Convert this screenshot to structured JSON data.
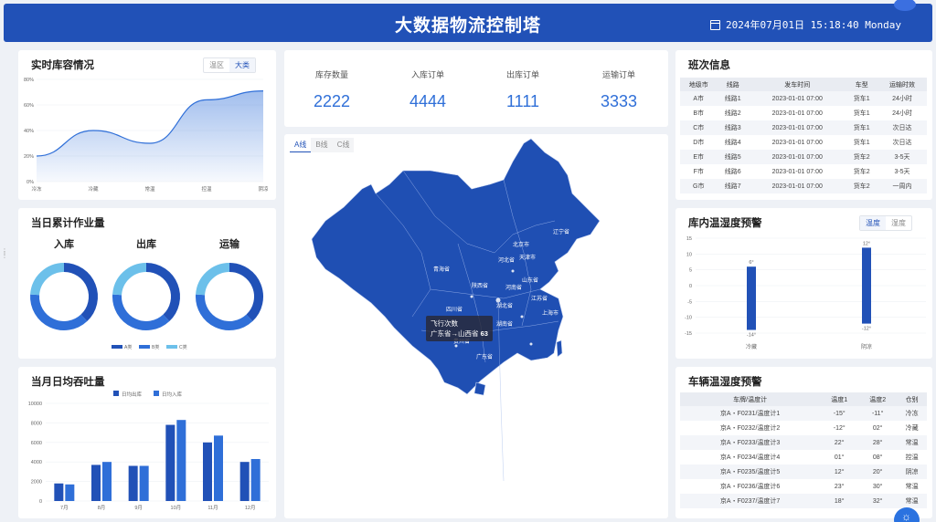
{
  "header": {
    "title": "大数据物流控制塔",
    "datetime": "2024年07月01日 15:18:40 Monday"
  },
  "inventory": {
    "title": "实时库容情况",
    "tabs": [
      "温区",
      "大类"
    ],
    "active_tab": "大类",
    "chart_data": {
      "type": "area",
      "categories": [
        "冷冻",
        "冷藏",
        "常温",
        "控温",
        "阴凉"
      ],
      "values": [
        20,
        40,
        30,
        64,
        71
      ],
      "ylim": [
        0,
        80
      ],
      "ytick_labels": [
        "0%",
        "20%",
        "40%",
        "60%",
        "80%"
      ],
      "color": "#2f6fd8"
    }
  },
  "daily_ops": {
    "title": "当日累计作业量",
    "chart_data": {
      "type": "pie",
      "charts": [
        {
          "title": "入库",
          "values": [
            38,
            38,
            24
          ]
        },
        {
          "title": "出库",
          "values": [
            38,
            38,
            24
          ]
        },
        {
          "title": "运输",
          "values": [
            38,
            38,
            24
          ]
        }
      ],
      "legend": [
        "A类",
        "B类",
        "C类"
      ],
      "colors": [
        "#2151b7",
        "#2f6fd8",
        "#6cc0ea"
      ]
    }
  },
  "monthly": {
    "title": "当月日均吞吐量",
    "chart_data": {
      "type": "bar",
      "categories": [
        "7月",
        "8月",
        "9月",
        "10月",
        "11月",
        "12月"
      ],
      "series": [
        {
          "name": "日均出库",
          "values": [
            1800,
            3700,
            3600,
            7800,
            6000,
            4000
          ],
          "color": "#2151b7"
        },
        {
          "name": "日均入库",
          "values": [
            1700,
            4000,
            3600,
            8300,
            6700,
            4300
          ],
          "color": "#2f6fd8"
        }
      ],
      "ylim": [
        0,
        10000
      ],
      "yticks": [
        0,
        2000,
        4000,
        6000,
        8000,
        10000
      ]
    }
  },
  "stats": [
    {
      "label": "库存数量",
      "value": "2222"
    },
    {
      "label": "入库订单",
      "value": "4444"
    },
    {
      "label": "出库订单",
      "value": "1111"
    },
    {
      "label": "运输订单",
      "value": "3333"
    }
  ],
  "map": {
    "tabs": [
      "A线",
      "B线",
      "C线"
    ],
    "active_tab": "A线",
    "labels": [
      "辽宁省",
      "北京市",
      "天津市",
      "河北省",
      "山东省",
      "青海省",
      "陕西省",
      "河南省",
      "四川省",
      "湖北省",
      "江苏省",
      "上海市",
      "湖南省",
      "贵州省",
      "广东省"
    ],
    "tooltip_title": "飞行次数",
    "tooltip_line": "广东省→山西省",
    "tooltip_value": "63",
    "color": "#1f4fb3"
  },
  "schedule": {
    "title": "班次信息",
    "columns": [
      "地级市",
      "线路",
      "发车时间",
      "车型",
      "运输时效"
    ],
    "rows": [
      [
        "A市",
        "线路1",
        "2023-01-01 07:00",
        "货车1",
        "24小时"
      ],
      [
        "B市",
        "线路2",
        "2023-01-01 07:00",
        "货车1",
        "24小时"
      ],
      [
        "C市",
        "线路3",
        "2023-01-01 07:00",
        "货车1",
        "次日达"
      ],
      [
        "D市",
        "线路4",
        "2023-01-01 07:00",
        "货车1",
        "次日达"
      ],
      [
        "E市",
        "线路5",
        "2023-01-01 07:00",
        "货车2",
        "3-5天"
      ],
      [
        "F市",
        "线路6",
        "2023-01-01 07:00",
        "货车2",
        "3-5天"
      ],
      [
        "G市",
        "线路7",
        "2023-01-01 07:00",
        "货车2",
        "一周内"
      ]
    ]
  },
  "warehouse_temp": {
    "title": "库内温湿度预警",
    "tabs": [
      "温度",
      "湿度"
    ],
    "active_tab": "温度",
    "chart_data": {
      "type": "bar",
      "categories": [
        "冷藏",
        "阴凉"
      ],
      "ranges": [
        {
          "min": -14,
          "max": 6
        },
        {
          "min": -12,
          "max": 12
        }
      ],
      "range_labels": [
        [
          "6°",
          "-14°"
        ],
        [
          "12°",
          "-12°"
        ]
      ],
      "yticks": [
        15,
        10,
        5,
        0,
        -5,
        -10,
        -15
      ],
      "ylim": [
        -15,
        15
      ],
      "color": "#2151b7"
    }
  },
  "vehicle_temp": {
    "title": "车辆温湿度预警",
    "columns": [
      "车牌/温度计",
      "温度1",
      "温度2",
      "仓别"
    ],
    "rows": [
      [
        "京A・F0231/温度计1",
        "-15°",
        "-11°",
        "冷冻"
      ],
      [
        "京A・F0232/温度计2",
        "-12°",
        "02°",
        "冷藏"
      ],
      [
        "京A・F0233/温度计3",
        "22°",
        "28°",
        "常温"
      ],
      [
        "京A・F0234/温度计4",
        "01°",
        "08°",
        "控温"
      ],
      [
        "京A・F0235/温度计5",
        "12°",
        "20°",
        "阴凉"
      ],
      [
        "京A・F0236/温度计6",
        "23°",
        "30°",
        "常温"
      ],
      [
        "京A・F0237/温度计7",
        "18°",
        "32°",
        "常温"
      ]
    ]
  }
}
